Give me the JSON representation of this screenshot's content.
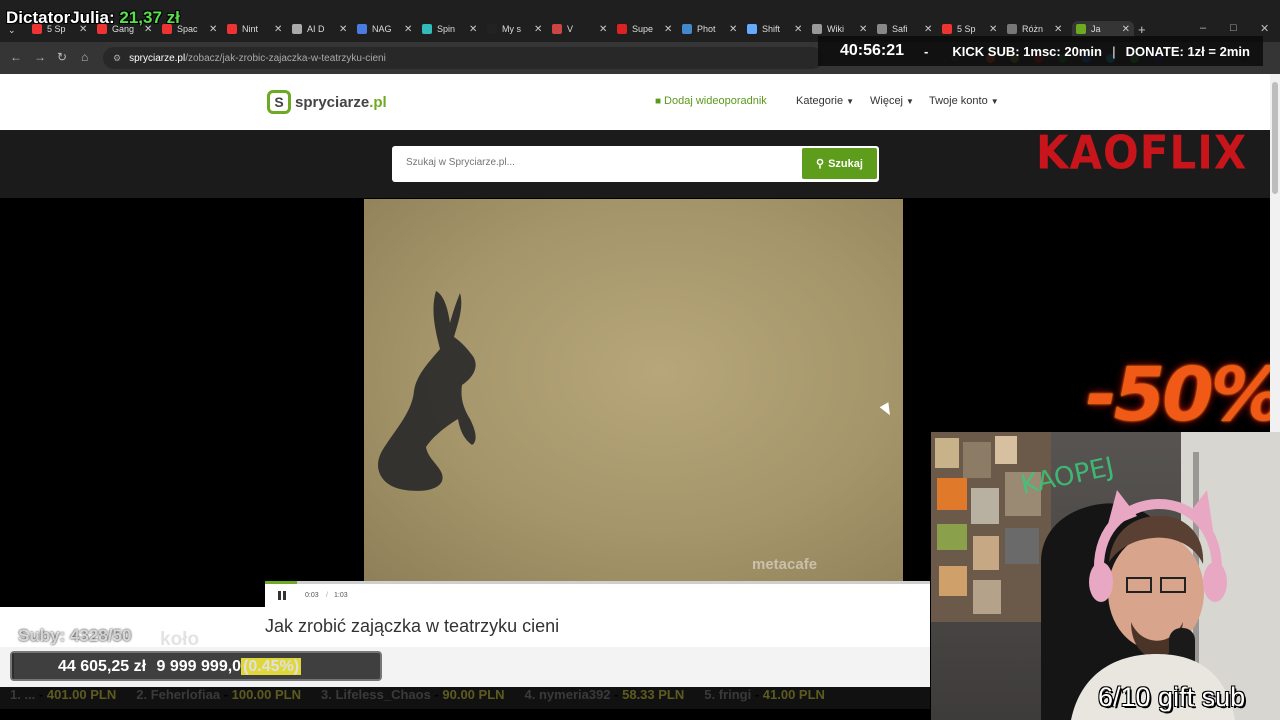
{
  "overlay": {
    "donor_name": "DictatorJulia:",
    "donor_amount": "21,37 zł",
    "timer": "40:56:21",
    "timer_dash": "-",
    "kick_sub": "KICK SUB: 1msc: 20min",
    "donate_rate": "DONATE: 1zł = 2min",
    "subs": "Suby: 4328/50",
    "ghost_text": "koło",
    "goal_current": "44 605,25 zł",
    "goal_target": "9 999 999,0",
    "goal_percent": "(0.45%)",
    "goal_fraction": 0.0045,
    "ticker": [
      {
        "name": "1. ...",
        "value": "401.00 PLN"
      },
      {
        "name": "2. Feherlofiaa",
        "value": "100.00 PLN"
      },
      {
        "name": "3. Lifeless_Chaos",
        "value": "90.00 PLN"
      },
      {
        "name": "4. nymeria392",
        "value": "58.33 PLN"
      },
      {
        "name": "5. fringi",
        "value": "41.00 PLN"
      }
    ],
    "kaoflix": "KAOFLIX",
    "promo": "-50%",
    "gift_sub": "6/10 gift sub",
    "webcam_graffiti": "KAOPEJ"
  },
  "browser": {
    "tabs": [
      {
        "label": "5 Sp",
        "color": "#e33"
      },
      {
        "label": "Gang",
        "color": "#e33"
      },
      {
        "label": "Spac",
        "color": "#e33"
      },
      {
        "label": "Nint",
        "color": "#e33"
      },
      {
        "label": "AI D",
        "color": "#aaa"
      },
      {
        "label": "NAG",
        "color": "#4a7be0"
      },
      {
        "label": "Spin",
        "color": "#3bb"
      },
      {
        "label": "My s",
        "color": "#222"
      },
      {
        "label": "V",
        "color": "#c44"
      },
      {
        "label": "Supe",
        "color": "#d22"
      },
      {
        "label": "Phot",
        "color": "#48c"
      },
      {
        "label": "Shift",
        "color": "#6af"
      },
      {
        "label": "Wiki",
        "color": "#999"
      },
      {
        "label": "Safi",
        "color": "#888"
      },
      {
        "label": "5 Sp",
        "color": "#e33"
      },
      {
        "label": "Różn",
        "color": "#777"
      },
      {
        "label": "Ja",
        "color": "#6ea922"
      }
    ],
    "url_host": "spryciarze.pl",
    "url_path": "/zobacz/jak-zrobic-zajaczka-w-teatrzyku-cieni"
  },
  "site": {
    "logo_name": "spryciarze",
    "logo_tld": ".pl",
    "nav_add": "Dodaj wideoporadnik",
    "nav_categories": "Kategorie",
    "nav_more": "Więcej",
    "nav_account": "Twoje konto",
    "search_placeholder": "Szukaj w Spryciarze.pl...",
    "search_button": "Szukaj",
    "video_watermark": "metacafe",
    "video_current_time": "0:03",
    "video_time_sep": "/",
    "video_duration": "1:03",
    "video_progress": 0.0476,
    "video_title": "Jak zrobić zajączka w teatrzyku cieni"
  },
  "colors": {
    "brand_green": "#6ea922",
    "kaoflix_red": "#c8151b",
    "promo_orange": "#f15a16"
  }
}
